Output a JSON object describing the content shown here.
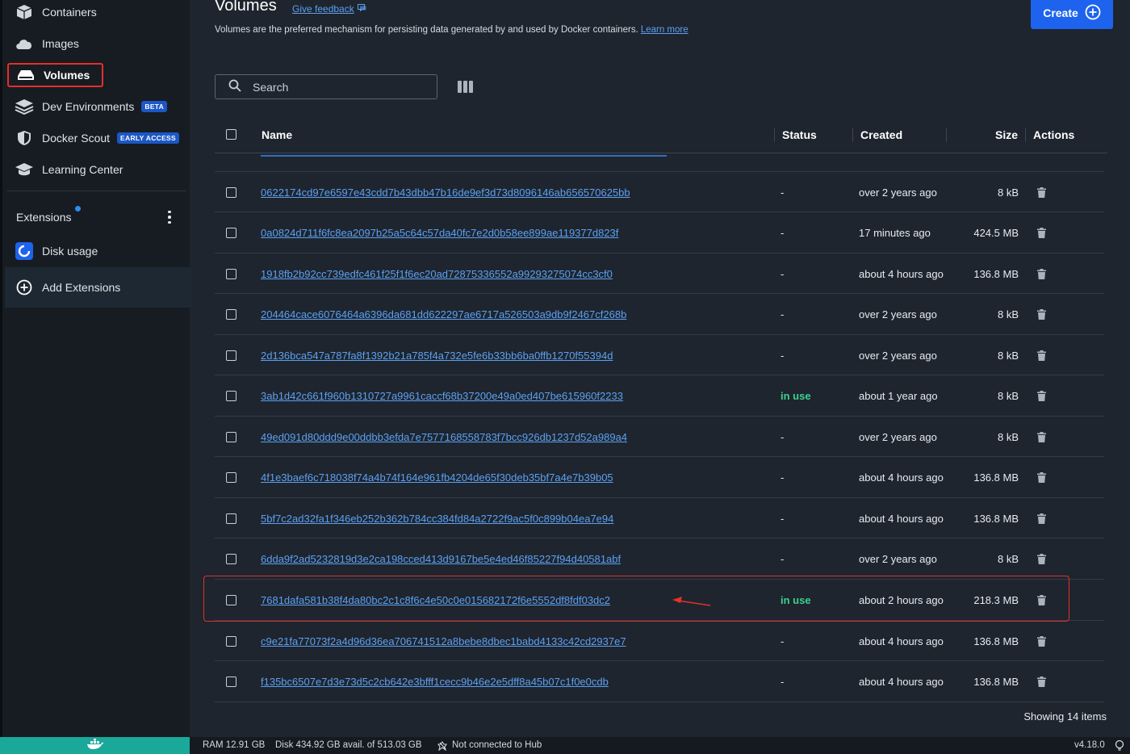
{
  "sidebar": {
    "items": [
      {
        "label": "Containers",
        "icon": "containers-icon"
      },
      {
        "label": "Images",
        "icon": "images-icon"
      },
      {
        "label": "Volumes",
        "icon": "volumes-icon"
      },
      {
        "label": "Dev Environments",
        "icon": "dev-environments-icon",
        "badge": "BETA"
      },
      {
        "label": "Docker Scout",
        "icon": "shield-icon",
        "badge": "EARLY ACCESS"
      },
      {
        "label": "Learning Center",
        "icon": "graduation-cap-icon"
      }
    ],
    "extensions_label": "Extensions",
    "disk_usage_label": "Disk usage",
    "add_extensions_label": "Add Extensions"
  },
  "header": {
    "title": "Volumes",
    "feedback": "Give feedback",
    "subtitle": "Volumes are the preferred mechanism for persisting data generated by and used by Docker containers.",
    "learn_more": "Learn more",
    "create": "Create"
  },
  "search": {
    "placeholder": "Search"
  },
  "table": {
    "columns": {
      "name": "Name",
      "status": "Status",
      "created": "Created",
      "size": "Size",
      "actions": "Actions"
    },
    "rows": [
      {
        "name": "0622174cd97e6597e43cdd7b43dbb47b16de9ef3d73d8096146ab656570625bb",
        "status": "-",
        "created": "over 2 years ago",
        "size": "8 kB"
      },
      {
        "name": "0a0824d711f6fc8ea2097b25a5c64c57da40fc7e2d0b58ee899ae119377d823f",
        "status": "-",
        "created": "17 minutes ago",
        "size": "424.5 MB"
      },
      {
        "name": "1918fb2b92cc739edfc461f25f1f6ec20ad72875336552a99293275074cc3cf0",
        "status": "-",
        "created": "about 4 hours ago",
        "size": "136.8 MB"
      },
      {
        "name": "204464cace6076464a6396da681dd622297ae6717a526503a9db9f2467cf268b",
        "status": "-",
        "created": "over 2 years ago",
        "size": "8 kB"
      },
      {
        "name": "2d136bca547a787fa8f1392b21a785f4a732e5fe6b33bb6ba0ffb1270f55394d",
        "status": "-",
        "created": "over 2 years ago",
        "size": "8 kB"
      },
      {
        "name": "3ab1d42c661f960b1310727a9961caccf68b37200e49a0ed407be615960f2233",
        "status": "in use",
        "created": "about 1 year ago",
        "size": "8 kB"
      },
      {
        "name": "49ed091d80ddd9e00ddbb3efda7e7577168558783f7bcc926db1237d52a989a4",
        "status": "-",
        "created": "over 2 years ago",
        "size": "8 kB"
      },
      {
        "name": "4f1e3baef6c718038f74a4b74f164e961fb4204de65f30deb35bf7a4e7b39b05",
        "status": "-",
        "created": "about 4 hours ago",
        "size": "136.8 MB"
      },
      {
        "name": "5bf7c2ad32fa1f346eb252b362b784cc384fd84a2722f9ac5f0c899b04ea7e94",
        "status": "-",
        "created": "about 4 hours ago",
        "size": "136.8 MB"
      },
      {
        "name": "6dda9f2ad5232819d3e2ca198cced413d9167be5e4ed46f85227f94d40581abf",
        "status": "-",
        "created": "over 2 years ago",
        "size": "8 kB"
      },
      {
        "name": "7681dafa581b38f4da80bc2c1c8f6c4e50c0e015682172f6e5552df8fdf03dc2",
        "status": "in use",
        "created": "about 2 hours ago",
        "size": "218.3 MB"
      },
      {
        "name": "c9e21fa77073f2a4d96d36ea706741512a8bebe8dbec1babd4133c42cd2937e7",
        "status": "-",
        "created": "about 4 hours ago",
        "size": "136.8 MB"
      },
      {
        "name": "f135bc6507e7d3e73d5c2cb642e3bfff1cecc9b46e2e5dff8a45b07c1f0e0cdb",
        "status": "-",
        "created": "about 4 hours ago",
        "size": "136.8 MB"
      }
    ],
    "showing": "Showing 14 items"
  },
  "footer": {
    "ram": "RAM 12.91 GB",
    "disk": "Disk 434.92 GB avail. of 513.03 GB",
    "hub": "Not connected to Hub",
    "version": "v4.18.0"
  },
  "colors": {
    "accent": "#1d63ed",
    "in_use": "#3ecf8e",
    "highlight": "#e5302a",
    "link": "#5ca0f2"
  }
}
